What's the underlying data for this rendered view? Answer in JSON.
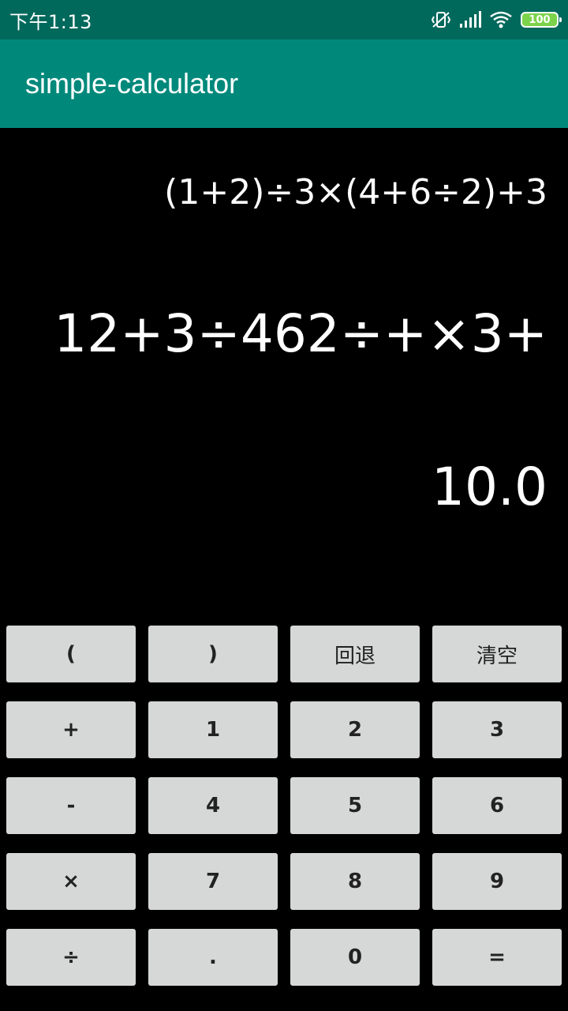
{
  "status_bar": {
    "time": "下午1:13",
    "battery": "100"
  },
  "app_bar": {
    "title": "simple-calculator"
  },
  "display": {
    "expression": "(1+2)÷3×(4+6÷2)+3",
    "postfix": "12+3÷462÷+×3+",
    "result": "10.0"
  },
  "keypad": {
    "open_paren": "(",
    "close_paren": ")",
    "backspace": "回退",
    "clear": "清空",
    "plus": "+",
    "one": "1",
    "two": "2",
    "three": "3",
    "minus": "-",
    "four": "4",
    "five": "5",
    "six": "6",
    "multiply": "×",
    "seven": "7",
    "eight": "8",
    "nine": "9",
    "divide": "÷",
    "dot": ".",
    "zero": "0",
    "equals": "="
  }
}
